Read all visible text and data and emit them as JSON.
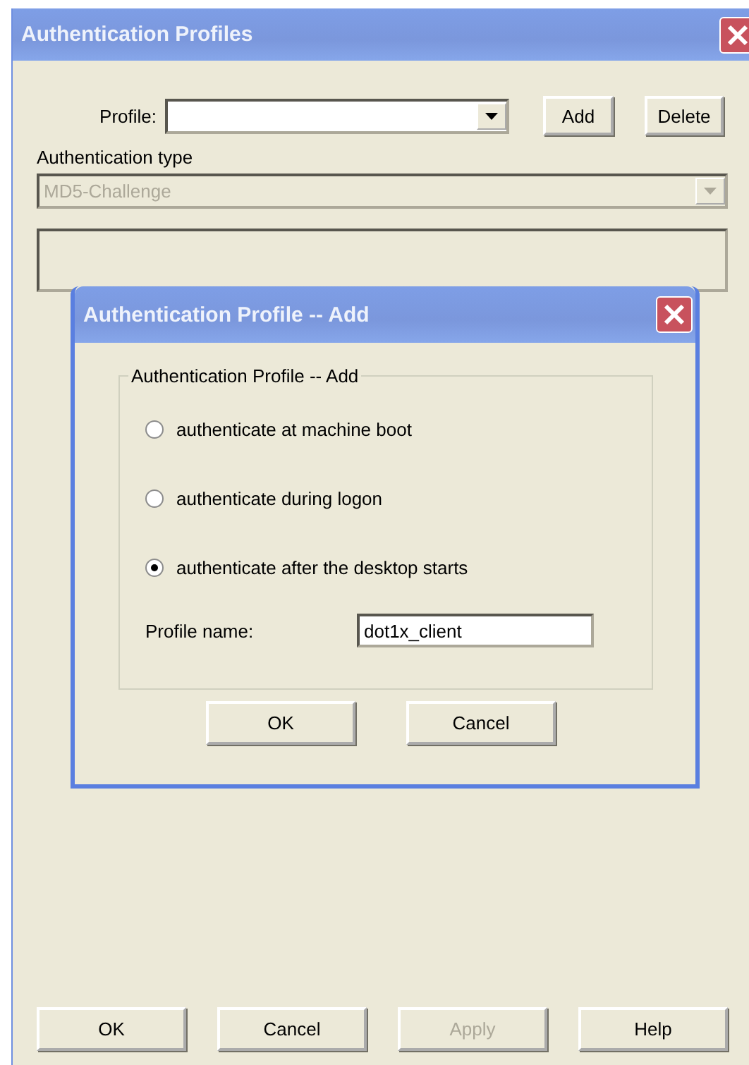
{
  "window": {
    "title": "Authentication Profiles"
  },
  "profile": {
    "label": "Profile:"
  },
  "profile_buttons": [
    "Add",
    "Delete"
  ],
  "authentication_type": {
    "label": "Authentication type",
    "value": "MD5-Challenge",
    "disabled": true
  },
  "dialog": {
    "title": "Authentication Profile -- Add",
    "group_title": "Authentication Profile -- Add",
    "options": [
      {
        "label": "authenticate at machine boot",
        "selected": false
      },
      {
        "label": "authenticate during logon",
        "selected": false
      },
      {
        "label": "authenticate after the desktop starts",
        "selected": true
      }
    ],
    "profile_name": {
      "label": "Profile name:",
      "value": "dot1x_client"
    },
    "buttons": [
      "OK",
      "Cancel"
    ]
  },
  "buttons": [
    {
      "label": "OK",
      "disabled": false
    },
    {
      "label": "Cancel",
      "disabled": false
    },
    {
      "label": "Apply",
      "disabled": true
    },
    {
      "label": "Help",
      "disabled": false
    }
  ]
}
